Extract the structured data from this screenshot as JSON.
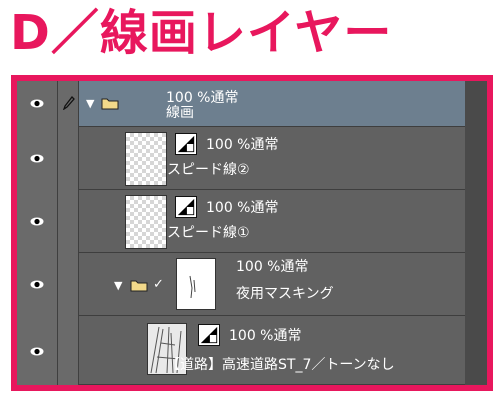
{
  "page_title": "D／線画レイヤー",
  "colors": {
    "accent": "#e8175d",
    "panel": "#616161",
    "selected": "#6d7f8f"
  },
  "layers": [
    {
      "mode": "100 %通常",
      "name": "線画",
      "type": "folder",
      "expanded": true,
      "selected": true,
      "has_pen": true
    },
    {
      "mode": "100 %通常",
      "name": "スピード線②",
      "type": "raster"
    },
    {
      "mode": "100 %通常",
      "name": "スピード線①",
      "type": "raster"
    },
    {
      "mode": "100 %通常",
      "name": "夜用マスキング",
      "type": "folder",
      "expanded": true,
      "checked": true
    },
    {
      "mode": "100 %通常",
      "name": "【道路】高速道路ST_7／トーンなし",
      "type": "raster"
    }
  ]
}
